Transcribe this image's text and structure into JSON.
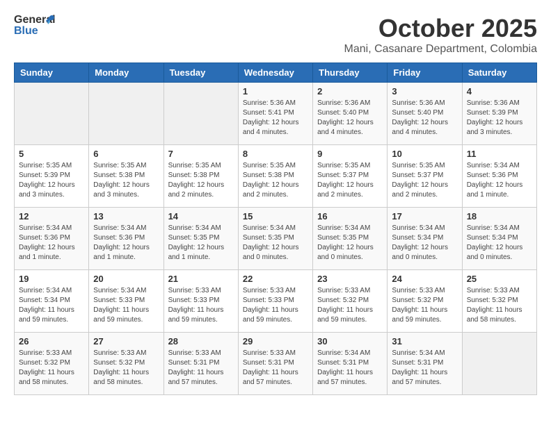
{
  "header": {
    "logo_general": "General",
    "logo_blue": "Blue",
    "title": "October 2025",
    "subtitle": "Mani, Casanare Department, Colombia"
  },
  "days_of_week": [
    "Sunday",
    "Monday",
    "Tuesday",
    "Wednesday",
    "Thursday",
    "Friday",
    "Saturday"
  ],
  "weeks": [
    [
      {
        "day": "",
        "info": ""
      },
      {
        "day": "",
        "info": ""
      },
      {
        "day": "",
        "info": ""
      },
      {
        "day": "1",
        "info": "Sunrise: 5:36 AM\nSunset: 5:41 PM\nDaylight: 12 hours\nand 4 minutes."
      },
      {
        "day": "2",
        "info": "Sunrise: 5:36 AM\nSunset: 5:40 PM\nDaylight: 12 hours\nand 4 minutes."
      },
      {
        "day": "3",
        "info": "Sunrise: 5:36 AM\nSunset: 5:40 PM\nDaylight: 12 hours\nand 4 minutes."
      },
      {
        "day": "4",
        "info": "Sunrise: 5:36 AM\nSunset: 5:39 PM\nDaylight: 12 hours\nand 3 minutes."
      }
    ],
    [
      {
        "day": "5",
        "info": "Sunrise: 5:35 AM\nSunset: 5:39 PM\nDaylight: 12 hours\nand 3 minutes."
      },
      {
        "day": "6",
        "info": "Sunrise: 5:35 AM\nSunset: 5:38 PM\nDaylight: 12 hours\nand 3 minutes."
      },
      {
        "day": "7",
        "info": "Sunrise: 5:35 AM\nSunset: 5:38 PM\nDaylight: 12 hours\nand 2 minutes."
      },
      {
        "day": "8",
        "info": "Sunrise: 5:35 AM\nSunset: 5:38 PM\nDaylight: 12 hours\nand 2 minutes."
      },
      {
        "day": "9",
        "info": "Sunrise: 5:35 AM\nSunset: 5:37 PM\nDaylight: 12 hours\nand 2 minutes."
      },
      {
        "day": "10",
        "info": "Sunrise: 5:35 AM\nSunset: 5:37 PM\nDaylight: 12 hours\nand 2 minutes."
      },
      {
        "day": "11",
        "info": "Sunrise: 5:34 AM\nSunset: 5:36 PM\nDaylight: 12 hours\nand 1 minute."
      }
    ],
    [
      {
        "day": "12",
        "info": "Sunrise: 5:34 AM\nSunset: 5:36 PM\nDaylight: 12 hours\nand 1 minute."
      },
      {
        "day": "13",
        "info": "Sunrise: 5:34 AM\nSunset: 5:36 PM\nDaylight: 12 hours\nand 1 minute."
      },
      {
        "day": "14",
        "info": "Sunrise: 5:34 AM\nSunset: 5:35 PM\nDaylight: 12 hours\nand 1 minute."
      },
      {
        "day": "15",
        "info": "Sunrise: 5:34 AM\nSunset: 5:35 PM\nDaylight: 12 hours\nand 0 minutes."
      },
      {
        "day": "16",
        "info": "Sunrise: 5:34 AM\nSunset: 5:35 PM\nDaylight: 12 hours\nand 0 minutes."
      },
      {
        "day": "17",
        "info": "Sunrise: 5:34 AM\nSunset: 5:34 PM\nDaylight: 12 hours\nand 0 minutes."
      },
      {
        "day": "18",
        "info": "Sunrise: 5:34 AM\nSunset: 5:34 PM\nDaylight: 12 hours\nand 0 minutes."
      }
    ],
    [
      {
        "day": "19",
        "info": "Sunrise: 5:34 AM\nSunset: 5:34 PM\nDaylight: 11 hours\nand 59 minutes."
      },
      {
        "day": "20",
        "info": "Sunrise: 5:34 AM\nSunset: 5:33 PM\nDaylight: 11 hours\nand 59 minutes."
      },
      {
        "day": "21",
        "info": "Sunrise: 5:33 AM\nSunset: 5:33 PM\nDaylight: 11 hours\nand 59 minutes."
      },
      {
        "day": "22",
        "info": "Sunrise: 5:33 AM\nSunset: 5:33 PM\nDaylight: 11 hours\nand 59 minutes."
      },
      {
        "day": "23",
        "info": "Sunrise: 5:33 AM\nSunset: 5:32 PM\nDaylight: 11 hours\nand 59 minutes."
      },
      {
        "day": "24",
        "info": "Sunrise: 5:33 AM\nSunset: 5:32 PM\nDaylight: 11 hours\nand 59 minutes."
      },
      {
        "day": "25",
        "info": "Sunrise: 5:33 AM\nSunset: 5:32 PM\nDaylight: 11 hours\nand 58 minutes."
      }
    ],
    [
      {
        "day": "26",
        "info": "Sunrise: 5:33 AM\nSunset: 5:32 PM\nDaylight: 11 hours\nand 58 minutes."
      },
      {
        "day": "27",
        "info": "Sunrise: 5:33 AM\nSunset: 5:32 PM\nDaylight: 11 hours\nand 58 minutes."
      },
      {
        "day": "28",
        "info": "Sunrise: 5:33 AM\nSunset: 5:31 PM\nDaylight: 11 hours\nand 57 minutes."
      },
      {
        "day": "29",
        "info": "Sunrise: 5:33 AM\nSunset: 5:31 PM\nDaylight: 11 hours\nand 57 minutes."
      },
      {
        "day": "30",
        "info": "Sunrise: 5:34 AM\nSunset: 5:31 PM\nDaylight: 11 hours\nand 57 minutes."
      },
      {
        "day": "31",
        "info": "Sunrise: 5:34 AM\nSunset: 5:31 PM\nDaylight: 11 hours\nand 57 minutes."
      },
      {
        "day": "",
        "info": ""
      }
    ]
  ]
}
